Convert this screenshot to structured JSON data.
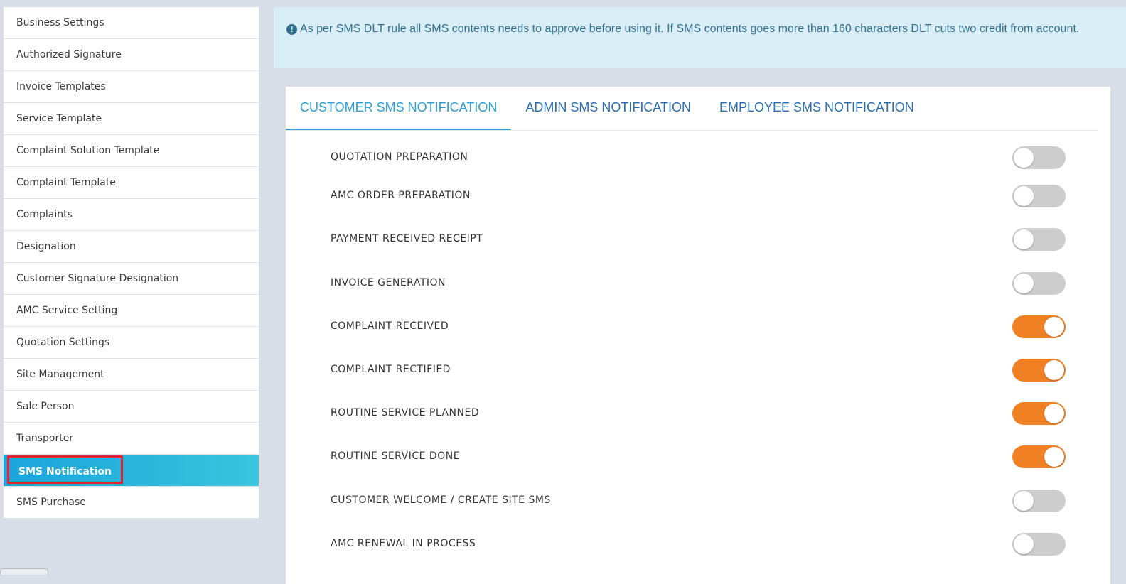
{
  "sidebar": {
    "items": [
      {
        "label": "Business Settings",
        "active": false
      },
      {
        "label": "Authorized Signature",
        "active": false
      },
      {
        "label": "Invoice Templates",
        "active": false
      },
      {
        "label": "Service Template",
        "active": false
      },
      {
        "label": "Complaint Solution Template",
        "active": false
      },
      {
        "label": "Complaint Template",
        "active": false
      },
      {
        "label": "Complaints",
        "active": false
      },
      {
        "label": "Designation",
        "active": false
      },
      {
        "label": "Customer Signature Designation",
        "active": false
      },
      {
        "label": "AMC Service Setting",
        "active": false
      },
      {
        "label": "Quotation Settings",
        "active": false
      },
      {
        "label": "Site Management",
        "active": false
      },
      {
        "label": "Sale Person",
        "active": false
      },
      {
        "label": "Transporter",
        "active": false
      },
      {
        "label": "SMS Notification",
        "active": true
      },
      {
        "label": "SMS Purchase",
        "active": false
      }
    ]
  },
  "alert": {
    "icon": "exclamation-circle-icon",
    "text": "As per SMS DLT rule all SMS contents needs to approve before using it. If SMS contents goes more than 160 characters DLT cuts two credit from account."
  },
  "tabs": [
    {
      "label": "CUSTOMER SMS NOTIFICATION",
      "active": true
    },
    {
      "label": "ADMIN SMS NOTIFICATION",
      "active": false
    },
    {
      "label": "EMPLOYEE SMS NOTIFICATION",
      "active": false
    }
  ],
  "notifications": [
    {
      "label": "QUOTATION PREPARATION",
      "enabled": false
    },
    {
      "label": "AMC ORDER PREPARATION",
      "enabled": false
    },
    {
      "label": "PAYMENT RECEIVED RECEIPT",
      "enabled": false
    },
    {
      "label": "INVOICE GENERATION",
      "enabled": false
    },
    {
      "label": "COMPLAINT RECEIVED",
      "enabled": true
    },
    {
      "label": "COMPLAINT RECTIFIED",
      "enabled": true
    },
    {
      "label": "ROUTINE SERVICE PLANNED",
      "enabled": true
    },
    {
      "label": "ROUTINE SERVICE DONE",
      "enabled": true
    },
    {
      "label": "CUSTOMER WELCOME / CREATE SITE SMS",
      "enabled": false
    },
    {
      "label": "AMC RENEWAL IN PROCESS",
      "enabled": false
    }
  ],
  "colors": {
    "accent": "#2a9fd8",
    "toggle_on": "#f08024",
    "toggle_off": "#cdcdcd",
    "alert_bg": "#d9edf7",
    "alert_text": "#31708f"
  }
}
